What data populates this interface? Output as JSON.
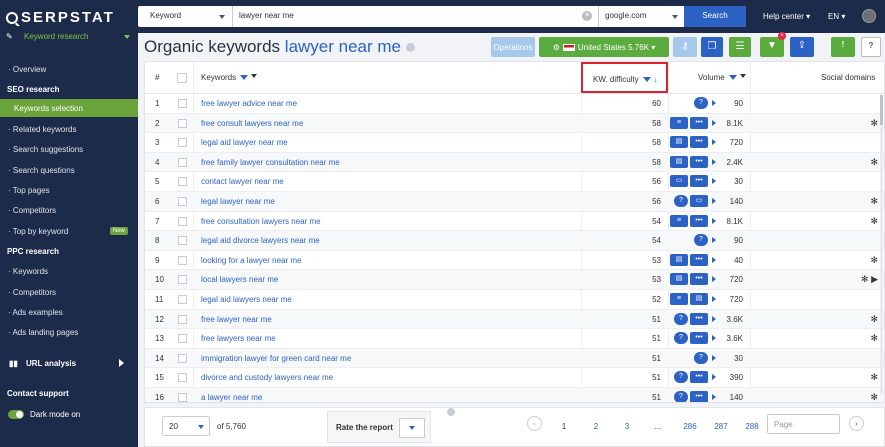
{
  "brand": {
    "name": "SERPSTAT"
  },
  "search": {
    "type": "Keyword",
    "query": "lawyer near me",
    "database": "google.com",
    "button": "Search"
  },
  "topnav": {
    "help": "Help center",
    "lang": "EN"
  },
  "sidebar": {
    "module": "Keyword research",
    "items": [
      {
        "label": "· Overview"
      },
      {
        "label": "SEO research"
      },
      {
        "label": "Keywords selection"
      },
      {
        "label": "· Related keywords"
      },
      {
        "label": "· Search suggestions"
      },
      {
        "label": "· Search questions"
      },
      {
        "label": "· Top pages"
      },
      {
        "label": "· Competitors"
      },
      {
        "label": "· Top by keyword",
        "badge": "New"
      },
      {
        "label": "PPC research"
      },
      {
        "label": "· Keywords"
      },
      {
        "label": "· Competitors"
      },
      {
        "label": "· Ads examples"
      },
      {
        "label": "· Ads landing pages"
      }
    ],
    "url_analysis": "URL analysis",
    "contact": "Contact support",
    "dark_mode": "Dark mode on"
  },
  "page": {
    "title_prefix": "Organic keywords",
    "title_keyword": "lawyer near me"
  },
  "toolbar": {
    "operations": "Operations",
    "country": "United States 5.76K"
  },
  "table": {
    "headers": {
      "num": "#",
      "keywords": "Keywords",
      "kd": "KW. difficulty",
      "volume": "Volume",
      "social": "Social domains"
    },
    "rows": [
      {
        "n": "1",
        "kw": "free lawyer advice near me",
        "kd": "60",
        "vol": "90",
        "social": ""
      },
      {
        "n": "2",
        "kw": "free consult lawyers near me",
        "kd": "58",
        "vol": "8.1K",
        "social": "✻"
      },
      {
        "n": "3",
        "kw": "legal aid lawyer near me",
        "kd": "58",
        "vol": "720",
        "social": ""
      },
      {
        "n": "4",
        "kw": "free family lawyer consultation near me",
        "kd": "58",
        "vol": "2.4K",
        "social": "✻"
      },
      {
        "n": "5",
        "kw": "contact lawyer near me",
        "kd": "56",
        "vol": "30",
        "social": ""
      },
      {
        "n": "6",
        "kw": "legal lawyer near me",
        "kd": "56",
        "vol": "140",
        "social": "✻"
      },
      {
        "n": "7",
        "kw": "free consultation lawyers near me",
        "kd": "54",
        "vol": "8.1K",
        "social": "✻"
      },
      {
        "n": "8",
        "kw": "legal aid divorce lawyers near me",
        "kd": "54",
        "vol": "90",
        "social": ""
      },
      {
        "n": "9",
        "kw": "looking for a lawyer near me",
        "kd": "53",
        "vol": "40",
        "social": "✻"
      },
      {
        "n": "10",
        "kw": "local lawyers near me",
        "kd": "53",
        "vol": "720",
        "social": "✻ ▶"
      },
      {
        "n": "11",
        "kw": "legal aid lawyers near me",
        "kd": "52",
        "vol": "720",
        "social": ""
      },
      {
        "n": "12",
        "kw": "free lawyer near me",
        "kd": "51",
        "vol": "3.6K",
        "social": "✻"
      },
      {
        "n": "13",
        "kw": "free lawyers near me",
        "kd": "51",
        "vol": "3.6K",
        "social": "✻"
      },
      {
        "n": "14",
        "kw": "immigration lawyer for green card near me",
        "kd": "51",
        "vol": "30",
        "social": ""
      },
      {
        "n": "15",
        "kw": "divorce and custody lawyers near me",
        "kd": "51",
        "vol": "390",
        "social": "✻"
      },
      {
        "n": "16",
        "kw": "a lawyer near me",
        "kd": "51",
        "vol": "140",
        "social": "✻"
      }
    ]
  },
  "footer": {
    "per_page": "20",
    "total": "of 5,760",
    "rate": "Rate the report",
    "pages": [
      "1",
      "2",
      "3",
      "...",
      "286",
      "287",
      "288"
    ],
    "page_placeholder": "Page"
  }
}
